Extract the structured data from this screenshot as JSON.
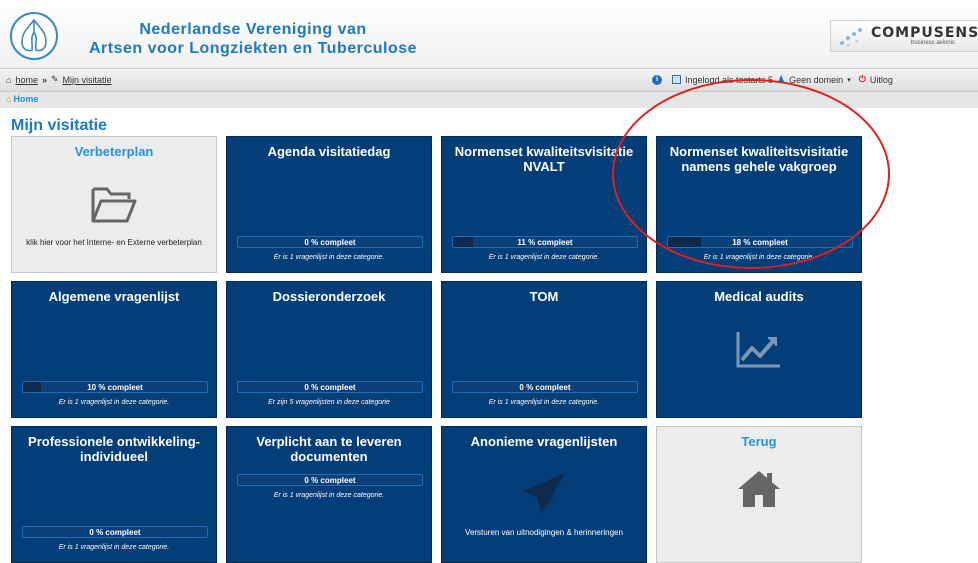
{
  "header": {
    "org_line1": "Nederlandse Vereniging van",
    "org_line2": "Artsen voor Longziekten en Tuberculose",
    "brand_name": "COMPUSENSE",
    "brand_sub": "business avionic",
    "colors": {
      "title": "#1d79c2",
      "tile": "#033e78",
      "accent": "#2594dc"
    }
  },
  "nav": {
    "home_label": "home",
    "separator": "»",
    "current_label": "Mijn visitatie",
    "user_text": "Ingelogd als testarts 5",
    "domain_text": "Geen domein",
    "logout_text": "Uitlog"
  },
  "breadcrumb": {
    "home": "Home"
  },
  "page": {
    "title": "Mijn visitatie"
  },
  "tiles": [
    {
      "title": "Verbeterplan",
      "desc": "klik hier voor het Interne- en Externe verbeterplan",
      "icon": "folder-icon"
    },
    {
      "title": "Agenda visitatiedag",
      "progress": 0,
      "progress_label": "0 % compleet",
      "note": "Er is 1 vragenlijst in deze categorie."
    },
    {
      "title": "Normenset kwaliteitsvisitatie NVALT",
      "progress": 11,
      "progress_label": "11 % compleet",
      "note": "Er is 1 vragenlijst in deze categorie."
    },
    {
      "title": "Normenset kwaliteitsvisitatie namens gehele vakgroep",
      "progress": 18,
      "progress_label": "18 % compleet",
      "note": "Er is 1 vragenlijst in deze categorie."
    },
    {
      "title": "Algemene vragenlijst",
      "progress": 10,
      "progress_label": "10 % compleet",
      "note": "Er is 1 vragenlijst in deze categorie."
    },
    {
      "title": "Dossieronderzoek",
      "progress": 0,
      "progress_label": "0 % compleet",
      "note": "Er zijn 5 vragenlijsten in deze categorie"
    },
    {
      "title": "TOM",
      "progress": 0,
      "progress_label": "0 % compleet",
      "note": "Er is 1 vragenlijst in deze categorie."
    },
    {
      "title": "Medical audits",
      "icon": "line-chart-icon"
    },
    {
      "title": "Professionele ontwikkeling-individueel",
      "progress": 0,
      "progress_label": "0 % compleet",
      "note": "Er is 1 vragenlijst in deze categorie."
    },
    {
      "title": "Verplicht aan te leveren documenten",
      "progress": 0,
      "progress_label": "0 % compleet",
      "note": "Er is 1 vragenlijst in deze categorie."
    },
    {
      "title": "Anonieme vragenlijsten",
      "desc": "Versturen van uitnodigingen & herinneringen",
      "icon": "paper-plane-icon"
    },
    {
      "title": "Terug",
      "icon": "house-icon"
    }
  ]
}
